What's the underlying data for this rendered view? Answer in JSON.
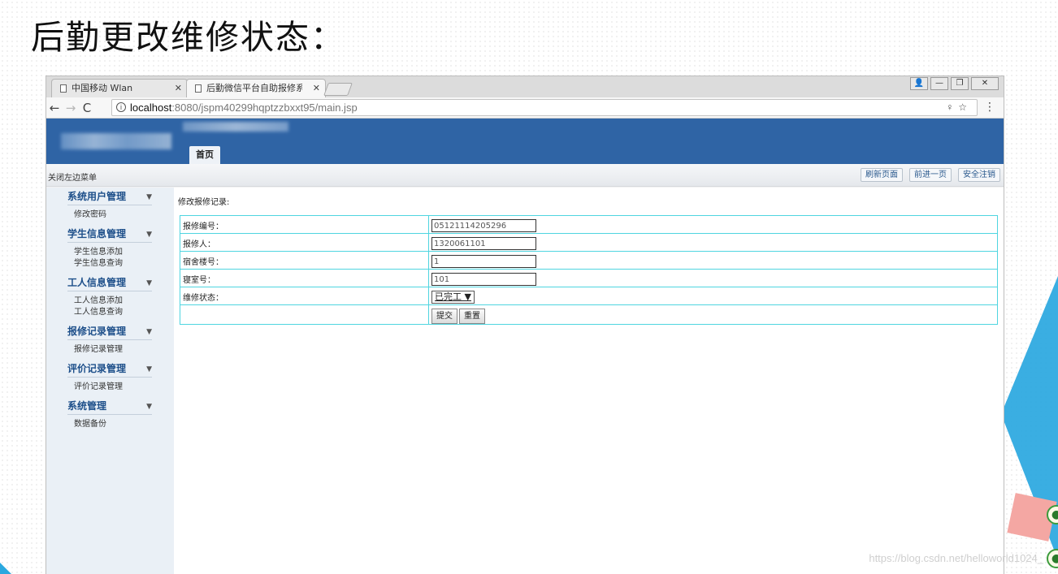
{
  "slide": {
    "title": "后勤更改维修状态：",
    "watermark": "https://blog.csdn.net/helloworld1024_"
  },
  "browser": {
    "tabs": [
      {
        "label": "中国移动 Wlan",
        "active": false
      },
      {
        "label": "后勤微信平台自助报修系",
        "active": true
      }
    ],
    "url_host": "localhost",
    "url_path": ":8080/jspm40299hqptzzbxxt95/main.jsp",
    "window_controls": [
      "person-icon",
      "minimize-icon",
      "maximize-icon",
      "close-icon"
    ]
  },
  "app": {
    "nav": {
      "home": "首页"
    },
    "toolbar": {
      "close_menu": "关闭左边菜单",
      "buttons": [
        "刷新页面",
        "前进一页",
        "安全注销"
      ]
    },
    "sidebar": [
      {
        "title": "系统用户管理",
        "items": [
          "修改密码"
        ]
      },
      {
        "title": "学生信息管理",
        "items": [
          "学生信息添加",
          "学生信息查询"
        ]
      },
      {
        "title": "工人信息管理",
        "items": [
          "工人信息添加",
          "工人信息查询"
        ]
      },
      {
        "title": "报修记录管理",
        "items": [
          "报修记录管理"
        ]
      },
      {
        "title": "评价记录管理",
        "items": [
          "评价记录管理"
        ]
      },
      {
        "title": "系统管理",
        "items": [
          "数据备份"
        ]
      }
    ],
    "form": {
      "caption": "修改报修记录:",
      "fields": [
        {
          "label": "报修编号：",
          "value": "05121114205296"
        },
        {
          "label": "报修人：",
          "value": "1320061101"
        },
        {
          "label": "宿舍楼号：",
          "value": "1"
        },
        {
          "label": "寝室号：",
          "value": "101"
        }
      ],
      "status_label": "维修状态：",
      "status_value": "已完工",
      "submit": "提交",
      "reset": "重置"
    }
  },
  "colors": {
    "header": "#2f64a5",
    "table_border": "#4fd5e0"
  }
}
